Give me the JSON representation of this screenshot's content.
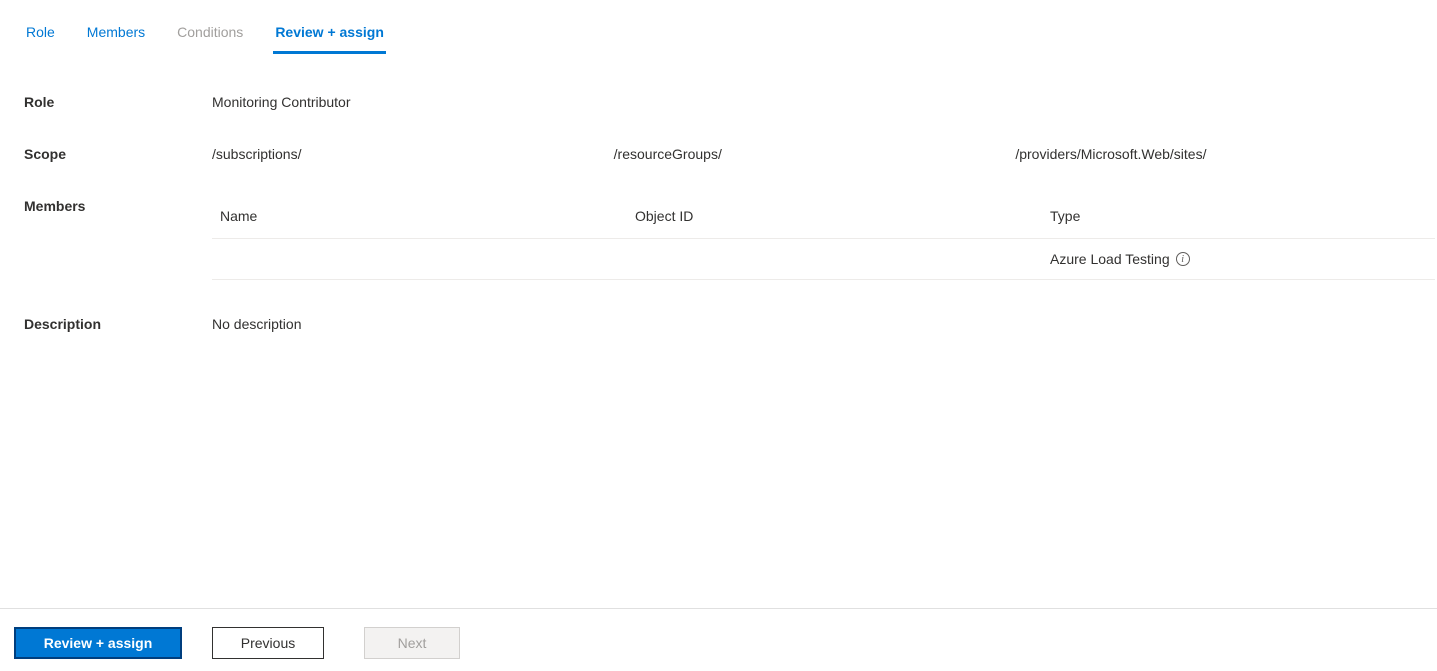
{
  "tabs": {
    "role": "Role",
    "members": "Members",
    "conditions": "Conditions",
    "review_assign": "Review + assign"
  },
  "fields": {
    "role": {
      "label": "Role",
      "value": "Monitoring Contributor"
    },
    "scope": {
      "label": "Scope",
      "parts": {
        "subscriptions": "/subscriptions/",
        "resource_groups": "/resourceGroups/",
        "providers": "/providers/Microsoft.Web/sites/"
      }
    },
    "members": {
      "label": "Members",
      "columns": {
        "name": "Name",
        "object_id": "Object ID",
        "type": "Type"
      },
      "rows": [
        {
          "name": "",
          "object_id": "",
          "type": "Azure Load Testing"
        }
      ]
    },
    "description": {
      "label": "Description",
      "value": "No description"
    }
  },
  "footer": {
    "review_assign": "Review + assign",
    "previous": "Previous",
    "next": "Next"
  }
}
